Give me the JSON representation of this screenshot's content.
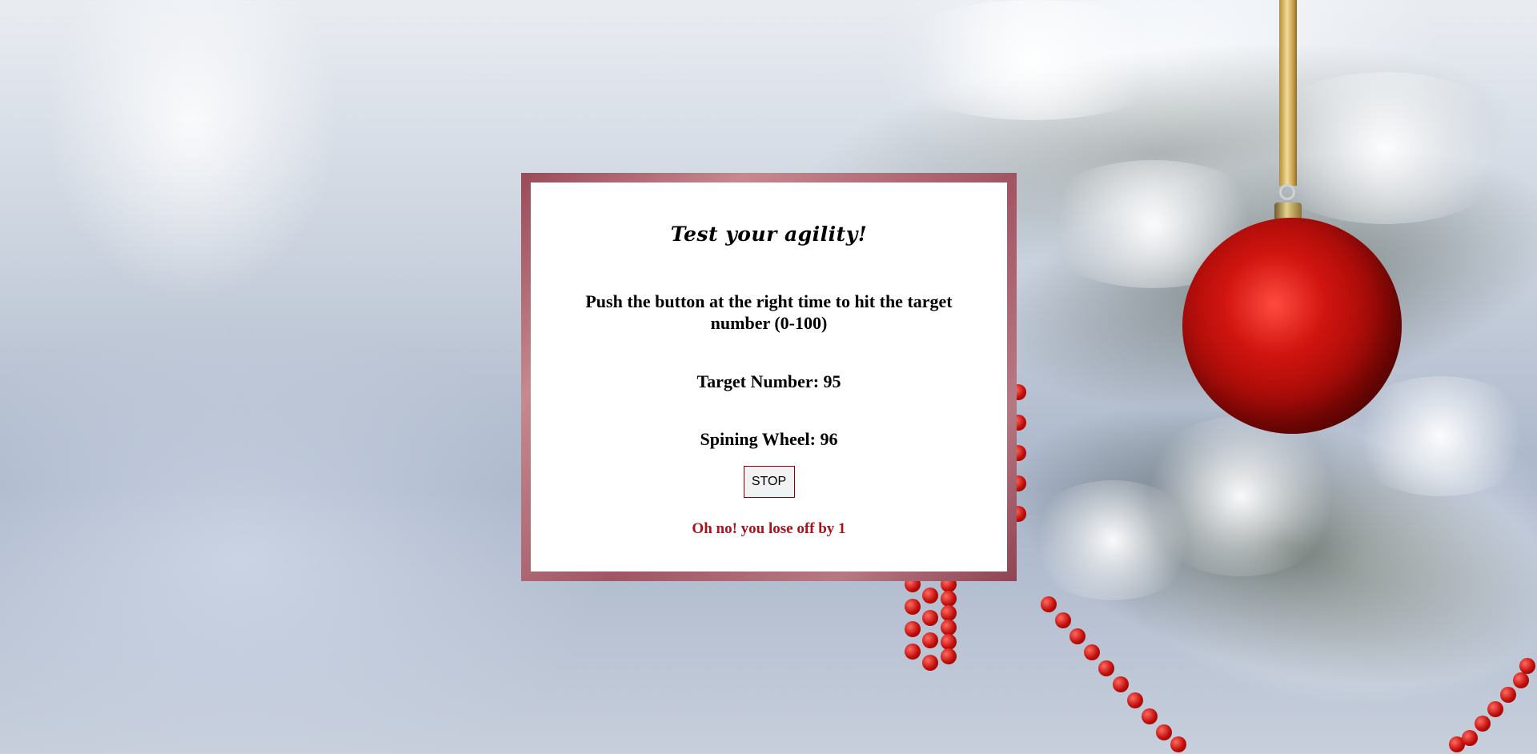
{
  "game": {
    "title": "Test your agility!",
    "instructions": "Push the button at the right time to hit the target number (0-100)",
    "target_label": "Target Number: 95",
    "target_value": 95,
    "wheel_label": "Spining Wheel: 96",
    "wheel_value": 96,
    "stop_label": "STOP",
    "result_text": "Oh no! you lose off by 1"
  },
  "colors": {
    "frame": "#a15563",
    "result": "#a8121a",
    "button_border": "#8b0000",
    "ornament": "#d0140f"
  }
}
